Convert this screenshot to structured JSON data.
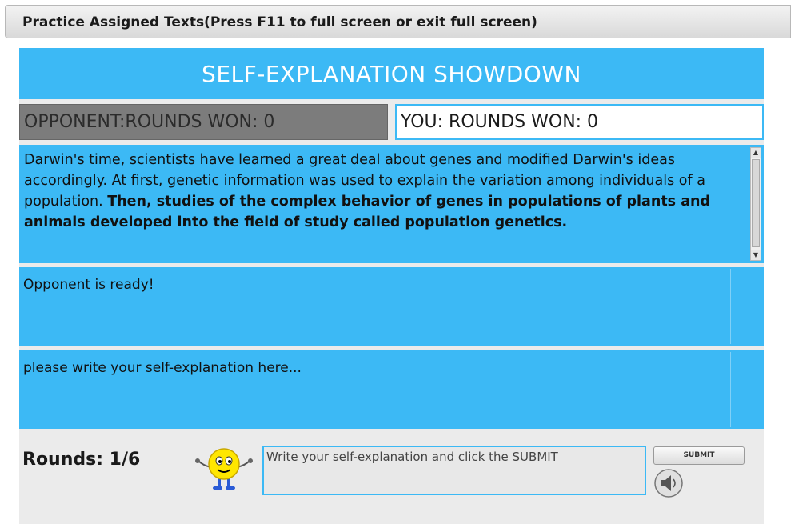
{
  "window": {
    "title": "Practice Assigned Texts(Press F11 to full screen or exit full screen)"
  },
  "game": {
    "header": "SELF-EXPLANATION SHOWDOWN",
    "opponent_score": "OPPONENT:ROUNDS WON: 0",
    "your_score": "YOU: ROUNDS WON: 0",
    "text_plain": "Darwin's time, scientists have learned a great deal about genes and modified Darwin's ideas accordingly. At first, genetic information was used to explain the variation among individuals of a population. ",
    "text_bold": "Then, studies of the complex behavior of genes in populations of plants and animals developed into the field of study called population genetics.",
    "opponent_message": "Opponent is ready!",
    "explanation_placeholder": "please write your self-explanation here...",
    "rounds": "Rounds: 1/6",
    "hint": "Write your self-explanation and click the SUBMIT",
    "submit_label": "SUBMIT"
  },
  "icons": {
    "scroll_up": "scroll-up-arrow",
    "scroll_down": "scroll-down-arrow",
    "mascot": "smiley-mascot",
    "audio": "speaker-icon"
  },
  "colors": {
    "accent": "#3cb9f5",
    "opponent_bg": "#7c7c7c",
    "panel_bg": "#ebebeb"
  }
}
